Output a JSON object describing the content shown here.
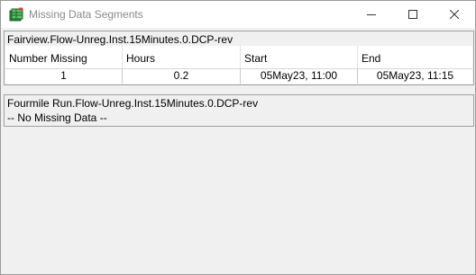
{
  "window": {
    "title": "Missing Data Segments",
    "icon": "spreadsheet-app-icon",
    "controls": [
      "minimize-icon",
      "maximize-icon",
      "close-icon"
    ]
  },
  "segments": [
    {
      "name": "Fairview.Flow-Unreg.Inst.15Minutes.0.DCP-rev",
      "columns": [
        "Number Missing",
        "Hours",
        "Start",
        "End"
      ],
      "rows": [
        {
          "number_missing": "1",
          "hours": "0.2",
          "start": "05May23, 11:00",
          "end": "05May23, 11:15"
        }
      ]
    },
    {
      "name": "Fourmile Run.Flow-Unreg.Inst.15Minutes.0.DCP-rev",
      "status": "-- No Missing Data --"
    }
  ]
}
